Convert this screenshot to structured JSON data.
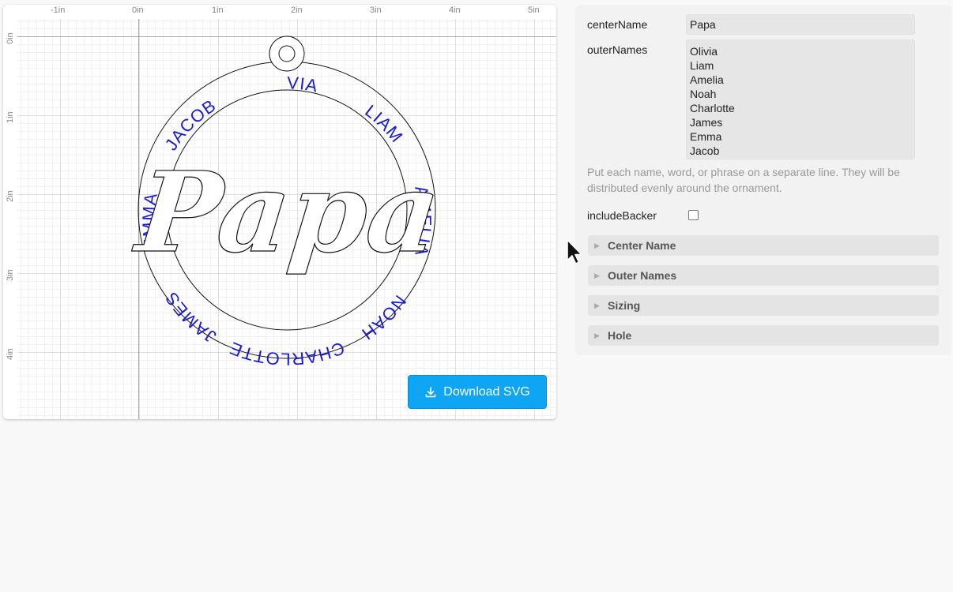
{
  "canvas": {
    "ruler_x_labels": [
      "-1in",
      "0in",
      "1in",
      "2in",
      "3in",
      "4in",
      "5in"
    ],
    "ruler_y_labels": [
      "0in",
      "1in",
      "2in",
      "3in",
      "4in"
    ],
    "center_name_text": "Papa",
    "outer_names_text": [
      "OLIVIA",
      "LIAM",
      "AMELIA",
      "NOAH",
      "CHARLOTTE",
      "JAMES",
      "EMMA",
      "JACOB"
    ],
    "outer_text_color": "#1a1acc",
    "download_label": "Download SVG",
    "download_icon": "download-icon",
    "button_color": "#0ea5f5"
  },
  "controls": {
    "center_name_label": "centerName",
    "center_name_value": "Papa",
    "outer_names_label": "outerNames",
    "outer_names_value": [
      "Olivia",
      "Liam",
      "Amelia",
      "Noah",
      "Charlotte",
      "James",
      "Emma",
      "Jacob"
    ],
    "help_text": "Put each name, word, or phrase on a separate line. They will be distributed evenly around the ornament.",
    "include_backer_label": "includeBacker",
    "include_backer_checked": false,
    "sections": [
      "Center Name",
      "Outer Names",
      "Sizing",
      "Hole"
    ]
  }
}
